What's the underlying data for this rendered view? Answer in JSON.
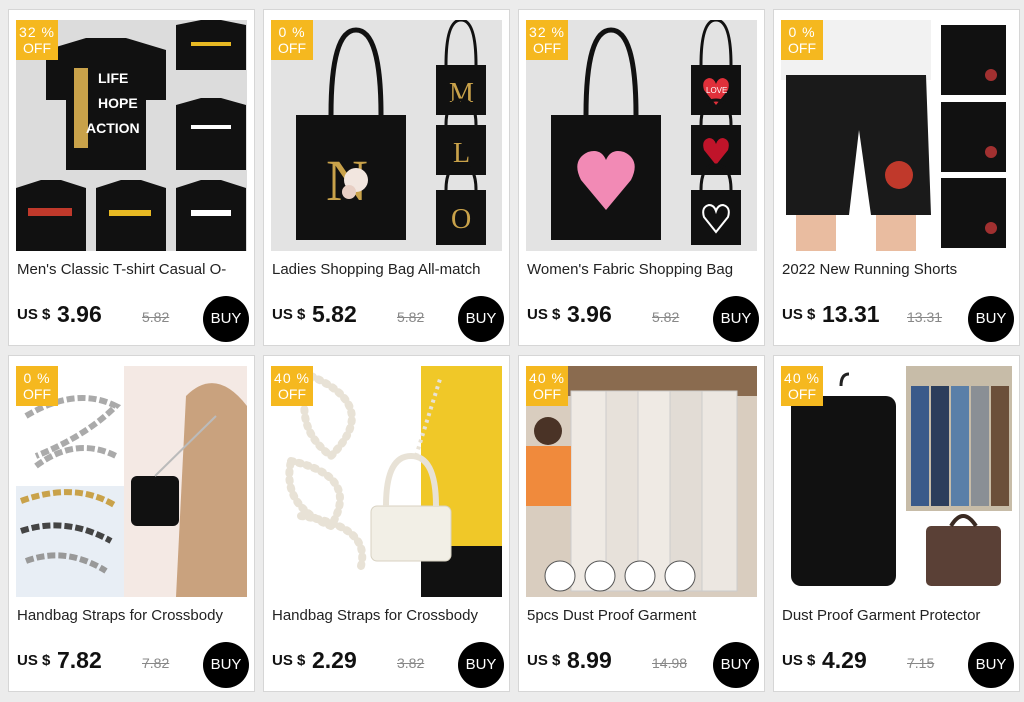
{
  "products": [
    {
      "discount_pct": "32 %",
      "off_label": "OFF",
      "title": "Men's Classic T-shirt Casual O-",
      "currency": "US $",
      "price": "3.96",
      "old_price": "5.82",
      "buy_label": "BUY",
      "image_text": [
        "LIFE",
        "HOPE",
        "ACTION"
      ]
    },
    {
      "discount_pct": "0 %",
      "off_label": "OFF",
      "title": "Ladies Shopping Bag All-match",
      "currency": "US $",
      "price": "5.82",
      "old_price": "5.82",
      "buy_label": "BUY",
      "image_text": [
        "N",
        "M",
        "L",
        "O"
      ]
    },
    {
      "discount_pct": "32 %",
      "off_label": "OFF",
      "title": "Women's Fabric Shopping Bag",
      "currency": "US $",
      "price": "3.96",
      "old_price": "5.82",
      "buy_label": "BUY",
      "image_text": [
        "LOVE"
      ]
    },
    {
      "discount_pct": "0 %",
      "off_label": "OFF",
      "title": "2022 New Running Shorts",
      "currency": "US $",
      "price": "13.31",
      "old_price": "13.31",
      "buy_label": "BUY"
    },
    {
      "discount_pct": "0 %",
      "off_label": "OFF",
      "title": "Handbag Straps for Crossbody",
      "currency": "US $",
      "price": "7.82",
      "old_price": "7.82",
      "buy_label": "BUY"
    },
    {
      "discount_pct": "40 %",
      "off_label": "OFF",
      "title": "Handbag Straps for Crossbody",
      "currency": "US $",
      "price": "2.29",
      "old_price": "3.82",
      "buy_label": "BUY"
    },
    {
      "discount_pct": "40 %",
      "off_label": "OFF",
      "title": "5pcs Dust Proof Garment",
      "currency": "US $",
      "price": "8.99",
      "old_price": "14.98",
      "buy_label": "BUY"
    },
    {
      "discount_pct": "40 %",
      "off_label": "OFF",
      "title": "Dust Proof Garment Protector",
      "currency": "US $",
      "price": "4.29",
      "old_price": "7.15",
      "buy_label": "BUY"
    }
  ],
  "colors": {
    "badge": "#f5b81f",
    "buy_button": "#000000",
    "page_bg": "#ececec"
  },
  "icons": [
    "tshirt-image",
    "tote-bag-image",
    "heart-bag-image",
    "shorts-image",
    "chain-strap-image",
    "pearl-strap-image",
    "garment-cover-image",
    "garment-bag-image"
  ]
}
